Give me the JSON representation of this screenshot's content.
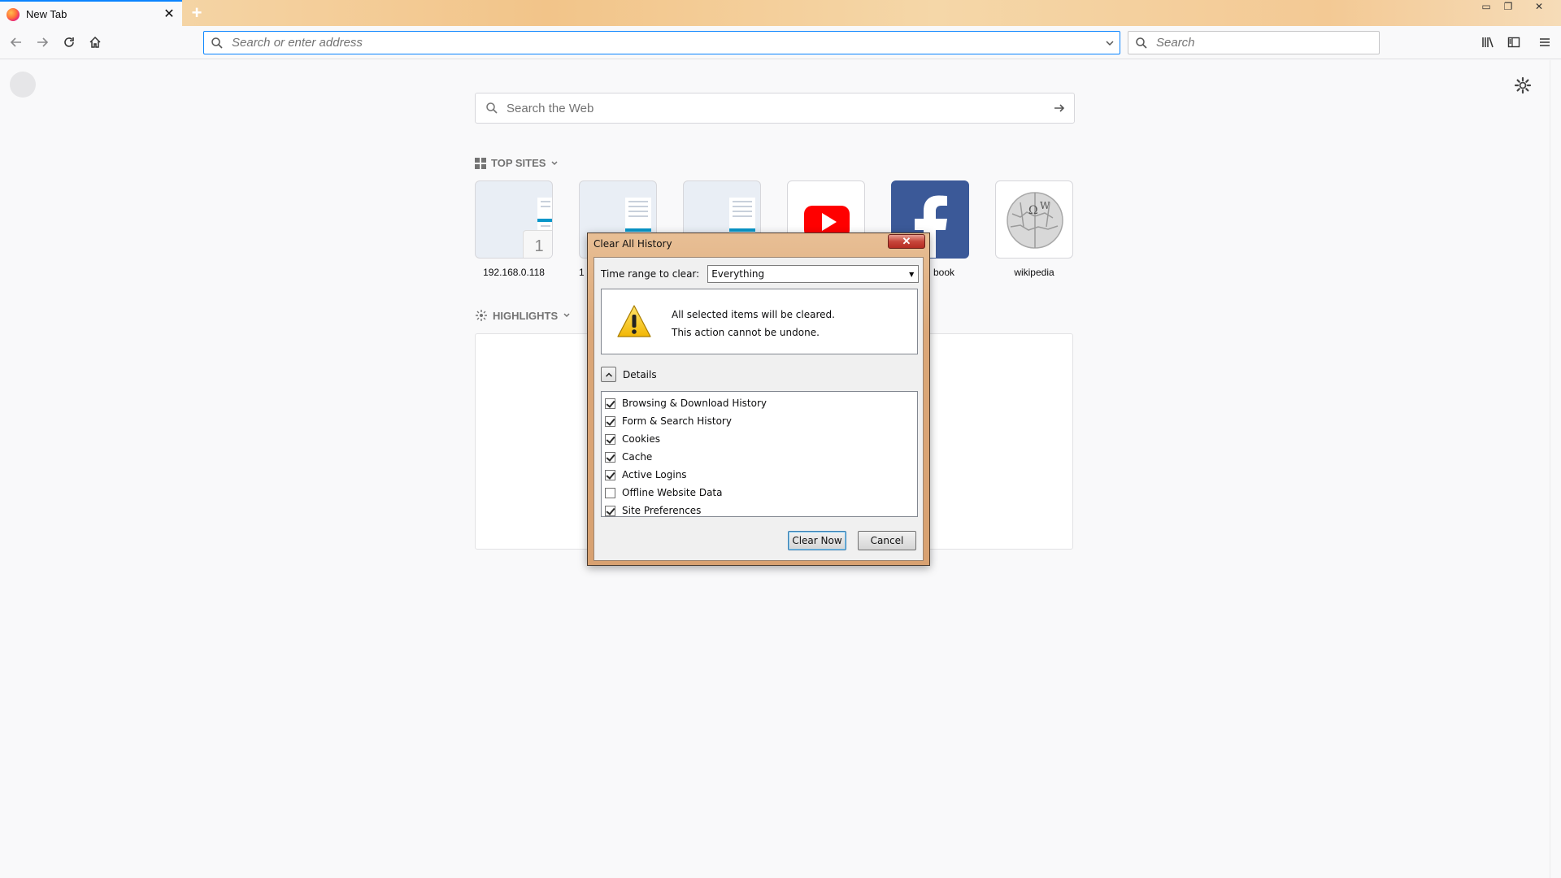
{
  "browser": {
    "tab": {
      "title": "New Tab",
      "close": "✕"
    },
    "new_tab": "+",
    "window_controls": {
      "minimize": "▭",
      "restore": "❐",
      "close": "✕"
    },
    "urlbar": {
      "placeholder": "Search or enter address"
    },
    "searchbar": {
      "placeholder": "Search"
    }
  },
  "newtab": {
    "web_search": {
      "placeholder": "Search the Web"
    },
    "top_sites": {
      "heading": "TOP SITES",
      "tiles": [
        {
          "label": "192.168.0.118",
          "pin": "1"
        },
        {
          "label": "1"
        },
        {
          "label": ""
        },
        {
          "label": ""
        },
        {
          "label": "book"
        },
        {
          "label": "wikipedia"
        }
      ]
    },
    "highlights": {
      "heading": "HIGHLIGHTS"
    }
  },
  "dialog": {
    "title": "Clear All History",
    "time_range_label": "Time range to clear:",
    "time_range_value": "Everything",
    "warning_line1": "All selected items will be cleared.",
    "warning_line2": "This action cannot be undone.",
    "details_label": "Details",
    "items": [
      {
        "label": "Browsing & Download History",
        "checked": true
      },
      {
        "label": "Form & Search History",
        "checked": true
      },
      {
        "label": "Cookies",
        "checked": true
      },
      {
        "label": "Cache",
        "checked": true
      },
      {
        "label": "Active Logins",
        "checked": true
      },
      {
        "label": "Offline Website Data",
        "checked": false
      },
      {
        "label": "Site Preferences",
        "checked": true
      }
    ],
    "clear_now": "Clear Now",
    "cancel": "Cancel"
  },
  "icons": [
    "firefox-favicon",
    "back-icon",
    "forward-icon",
    "reload-icon",
    "home-icon",
    "search-icon",
    "library-icon",
    "sidebar-icon",
    "menu-icon",
    "gear-icon",
    "arrow-right-icon",
    "grid-icon",
    "highlights-icon",
    "warning-icon",
    "chevron-up-icon"
  ],
  "colors": {
    "accent": "#0a84ff",
    "youtube": "#ff0000",
    "facebook": "#3b5998"
  }
}
